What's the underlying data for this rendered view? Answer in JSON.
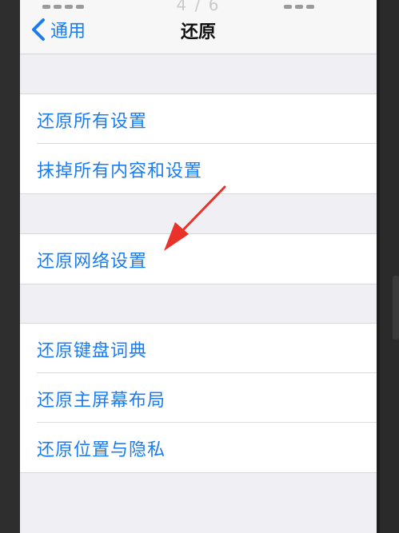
{
  "nav": {
    "counter": "4 / 6",
    "back_label": "通用",
    "title": "还原"
  },
  "groups": [
    {
      "items": [
        {
          "label": "还原所有设置"
        },
        {
          "label": "抹掉所有内容和设置"
        }
      ]
    },
    {
      "items": [
        {
          "label": "还原网络设置"
        }
      ]
    },
    {
      "items": [
        {
          "label": "还原键盘词典"
        },
        {
          "label": "还原主屏幕布局"
        },
        {
          "label": "还原位置与隐私"
        }
      ]
    }
  ],
  "colors": {
    "accent": "#1b7cf0",
    "background": "#efeff4",
    "annotation_arrow": "#e8322a"
  },
  "annotation": {
    "target": "还原网络设置",
    "icon": "red-pointer-arrow-icon"
  }
}
